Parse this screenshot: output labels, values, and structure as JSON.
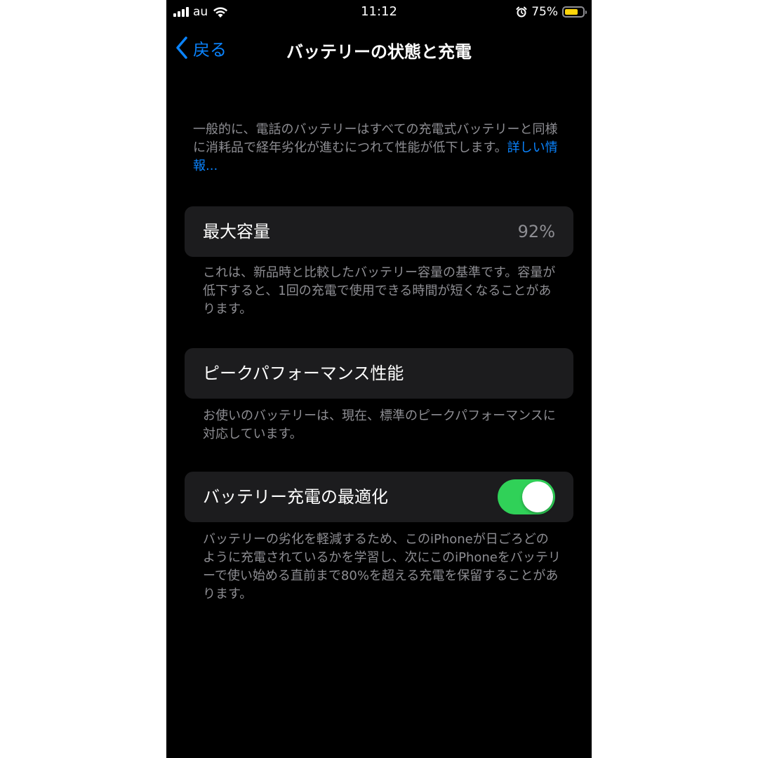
{
  "status_bar": {
    "carrier": "au",
    "time": "11:12",
    "battery_percent": "75%",
    "battery_level": 0.75,
    "signal_bars": 4,
    "icons": [
      "signal-icon",
      "wifi-icon",
      "alarm-icon",
      "battery-icon"
    ],
    "battery_color": "#ffd60a"
  },
  "nav": {
    "back_label": "戻る",
    "title": "バッテリーの状態と充電"
  },
  "intro": {
    "text": "一般的に、電話のバッテリーはすべての充電式バッテリーと同様に消耗品で経年劣化が進むにつれて性能が低下します。",
    "link": "詳しい情報..."
  },
  "max_capacity": {
    "label": "最大容量",
    "value": "92%",
    "footer": "これは、新品時と比較したバッテリー容量の基準です。容量が低下すると、1回の充電で使用できる時間が短くなることがあります。"
  },
  "peak_performance": {
    "label": "ピークパフォーマンス性能",
    "footer": "お使いのバッテリーは、現在、標準のピークパフォーマンスに対応しています。"
  },
  "optimized_charging": {
    "label": "バッテリー充電の最適化",
    "enabled": true,
    "toggle_color": "#30d158",
    "footer": "バッテリーの劣化を軽減するため、このiPhoneが日ごろどのように充電されているかを学習し、次にこのiPhoneをバッテリーで使い始める直前まで80%を超える充電を保留することがあります。"
  },
  "colors": {
    "background": "#000000",
    "cell_background": "#1c1c1e",
    "accent": "#0a84ff",
    "secondary_text": "#8e8e93"
  }
}
